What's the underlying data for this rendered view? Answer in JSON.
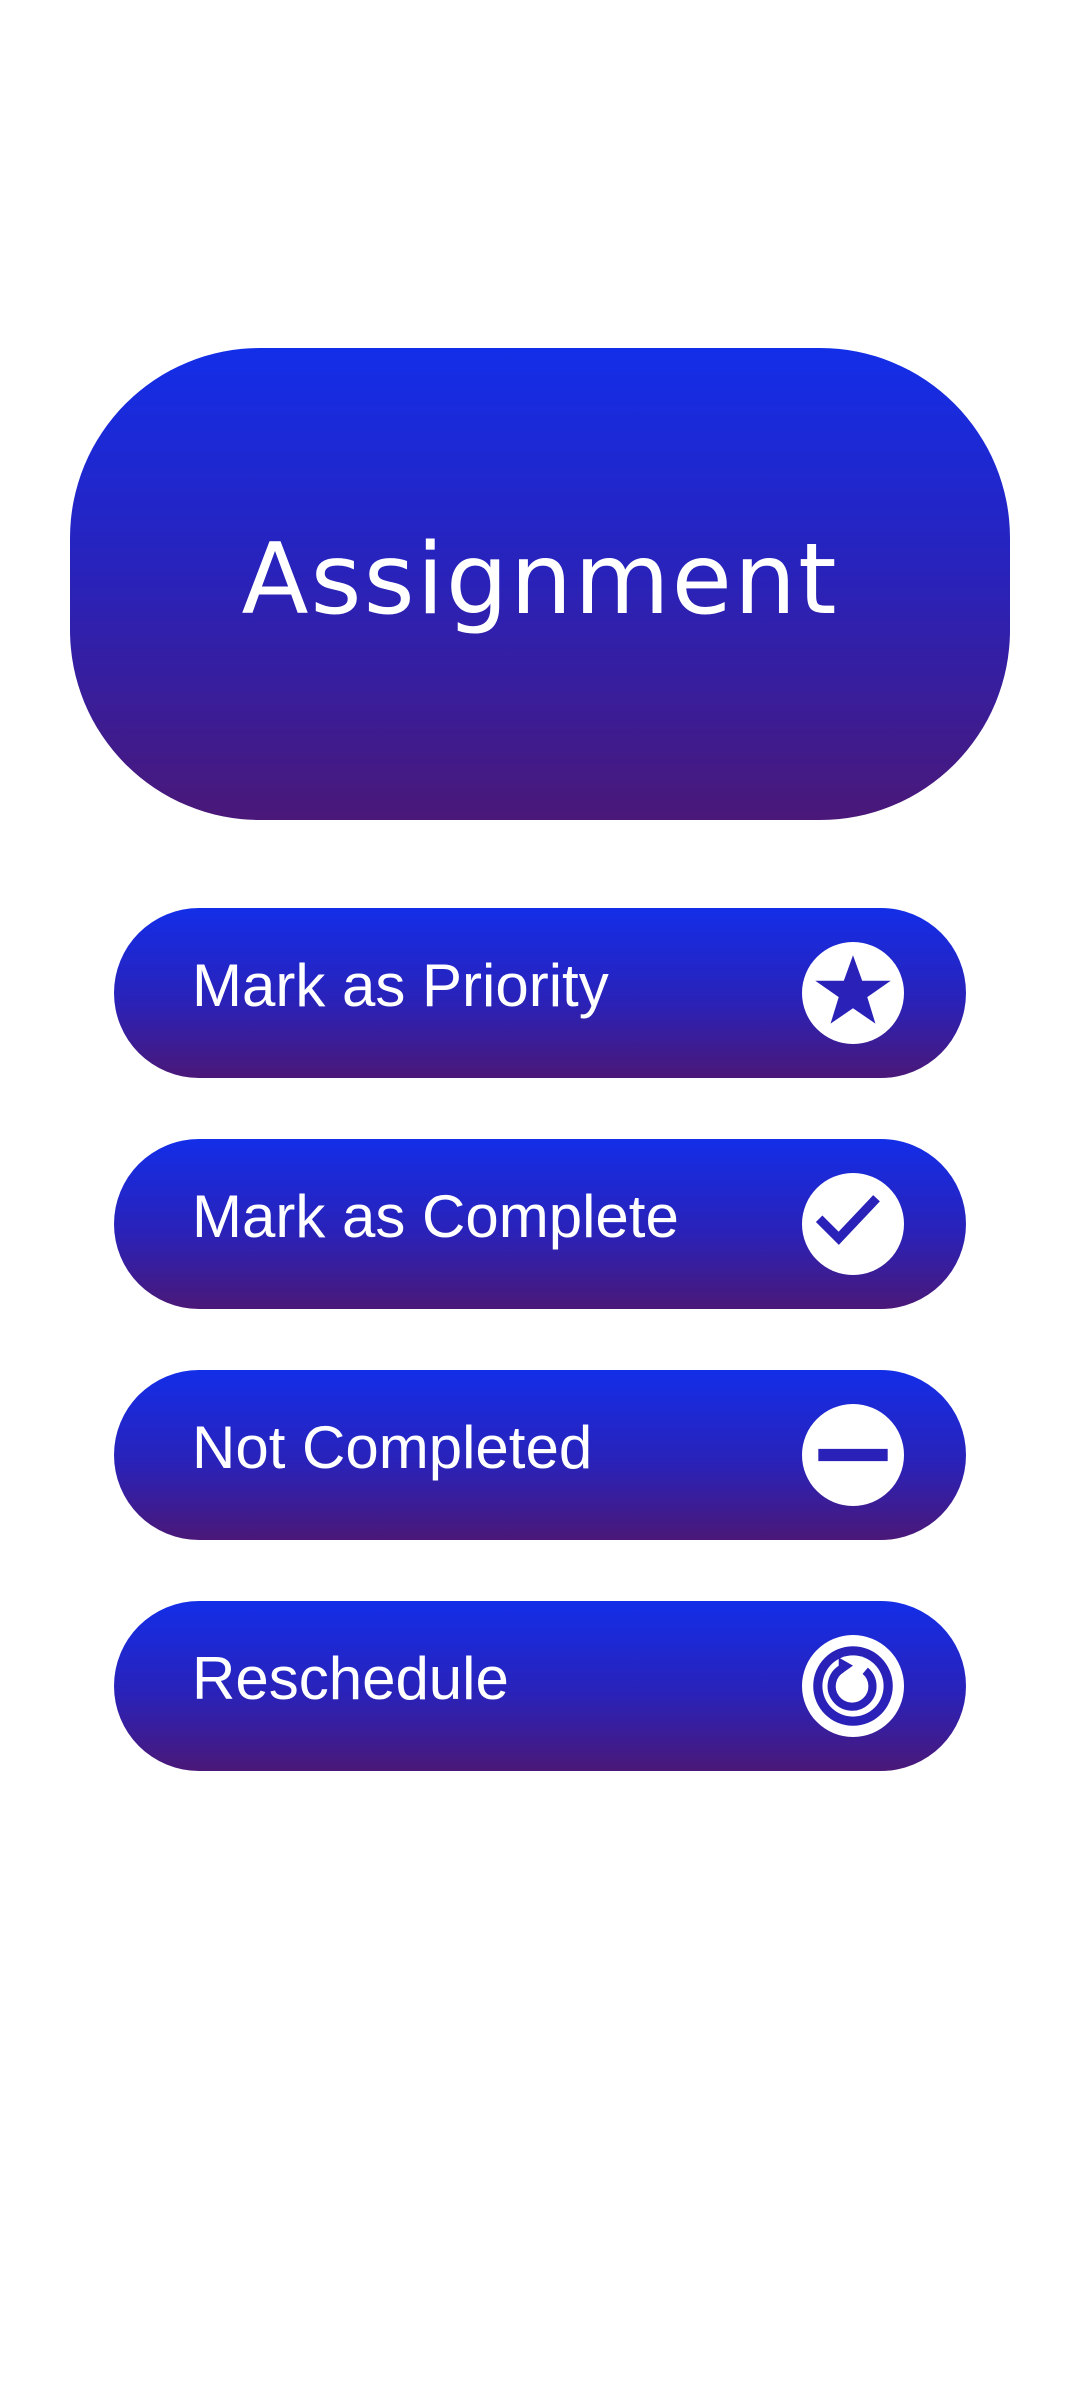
{
  "header": {
    "title": "Assignment"
  },
  "actions": [
    {
      "label": "Mark as Priority",
      "icon": "star-icon"
    },
    {
      "label": "Mark as Complete",
      "icon": "checkmark-icon"
    },
    {
      "label": "Not Completed",
      "icon": "minus-icon"
    },
    {
      "label": "Reschedule",
      "icon": "refresh-icon"
    }
  ],
  "colors": {
    "gradient_top": "#132ee8",
    "gradient_bottom": "#4a1878",
    "icon_circle": "#ffffff",
    "text": "#ffffff",
    "background": "#ffffff"
  }
}
